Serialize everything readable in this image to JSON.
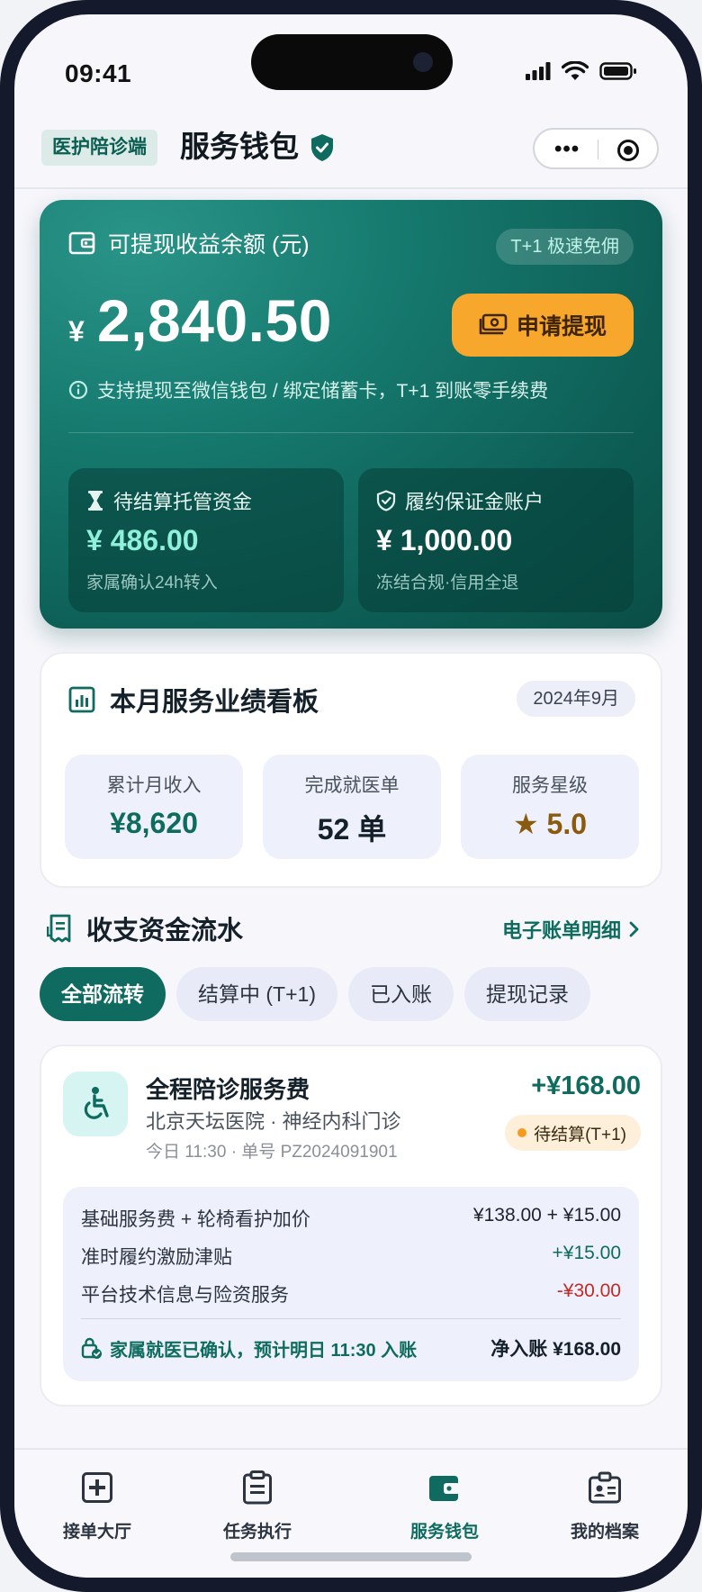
{
  "status_bar": {
    "time": "09:41"
  },
  "header": {
    "role_badge": "医护陪诊端",
    "title": "服务钱包"
  },
  "balance": {
    "label": "可提现收益余额 (元)",
    "speed_badge": "T+1 极速免佣",
    "currency_symbol": "¥",
    "amount": "2,840.50",
    "withdraw_label": "申请提现",
    "note": "支持提现至微信钱包 / 绑定储蓄卡，T+1 到账零手续费",
    "pending": {
      "title": "待结算托管资金",
      "amount": "¥ 486.00",
      "note": "家属确认24h转入"
    },
    "deposit": {
      "title": "履约保证金账户",
      "amount": "¥ 1,000.00",
      "note": "冻结合规·信用全退"
    }
  },
  "performance": {
    "title": "本月服务业绩看板",
    "month": "2024年9月",
    "stats": [
      {
        "label": "累计月收入",
        "value": "¥8,620"
      },
      {
        "label": "完成就医单",
        "value": "52 单"
      },
      {
        "label": "服务星级",
        "value": "★ 5.0"
      }
    ]
  },
  "ledger": {
    "title": "收支资金流水",
    "link": "电子账单明细",
    "tabs": [
      "全部流转",
      "结算中 (T+1)",
      "已入账",
      "提现记录"
    ],
    "active_tab": 0,
    "transaction": {
      "title": "全程陪诊服务费",
      "hospital": "北京天坛医院 · 神经内科门诊",
      "meta": "今日 11:30 · 单号 PZ2024091901",
      "amount": "+¥168.00",
      "status": "待结算(T+1)",
      "breakdown": [
        {
          "label": "基础服务费 + 轮椅看护加价",
          "value": "¥138.00 + ¥15.00"
        },
        {
          "label": "准时履约激励津贴",
          "value": "+¥15.00"
        },
        {
          "label": "平台技术信息与险资服务",
          "value": "-¥30.00"
        }
      ],
      "confirm_text": "家属就医已确认，预计明日 11:30 入账",
      "net_text": "净入账 ¥168.00"
    }
  },
  "tabbar": {
    "items": [
      "接单大厅",
      "任务执行",
      "服务钱包",
      "我的档案"
    ],
    "active": 2
  },
  "colors": {
    "brand_teal": "#0f6b5f",
    "accent_orange": "#f7a72b",
    "negative_red": "#c22a26"
  },
  "icons": [
    "wallet-icon",
    "info-icon",
    "hourglass-icon",
    "shield-check-icon",
    "chart-icon",
    "receipt-icon",
    "wheelchair-icon",
    "lock-check-icon",
    "medical-plus-icon",
    "clipboard-icon",
    "id-badge-icon",
    "chevron-right-icon"
  ]
}
